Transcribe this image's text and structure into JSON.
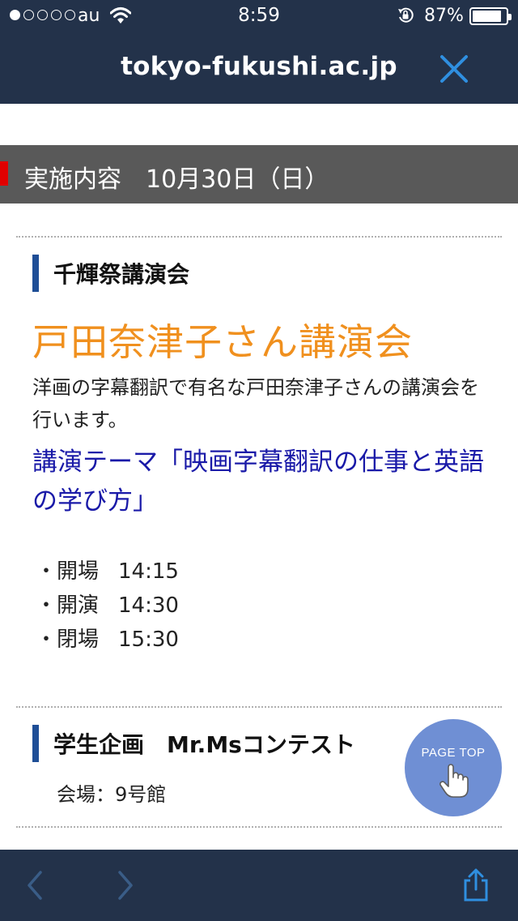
{
  "status": {
    "signal_dots_on": 1,
    "signal_dots_total": 5,
    "carrier": "au",
    "time": "8:59",
    "battery_text": "87%",
    "battery_level": 0.87
  },
  "browser": {
    "url": "tokyo-fukushi.ac.jp"
  },
  "section": {
    "title": "実施内容　10月30日（日）"
  },
  "lecture": {
    "category": "千輝祭講演会",
    "title": "戸田奈津子さん講演会",
    "description": "洋画の字幕翻訳で有名な戸田奈津子さんの講演会を行います。",
    "theme": "講演テーマ「映画字幕翻訳の仕事と英語の学び方」",
    "schedule": [
      {
        "label": "・開場",
        "time": "14:15"
      },
      {
        "label": "・開演",
        "time": "14:30"
      },
      {
        "label": "・閉場",
        "time": "15:30"
      }
    ]
  },
  "contest": {
    "title": "学生企画　Mr.Msコンテスト",
    "venue": "会場：9号館"
  },
  "page_top": {
    "label": "PAGE TOP"
  },
  "colors": {
    "bar_bg": "#23324a",
    "section_bg": "#595959",
    "accent_red": "#e10000",
    "heading_bar": "#1e4e96",
    "title_orange": "#f0901e",
    "theme_blue": "#1a1aa8",
    "page_top_bg": "#6f8fd4",
    "link_blue": "#2f8fe0"
  },
  "icons": [
    "wifi-icon",
    "rotation-lock-icon",
    "battery-icon",
    "close-icon",
    "hand-pointer-icon",
    "back-arrow-icon",
    "forward-arrow-icon",
    "share-icon"
  ]
}
